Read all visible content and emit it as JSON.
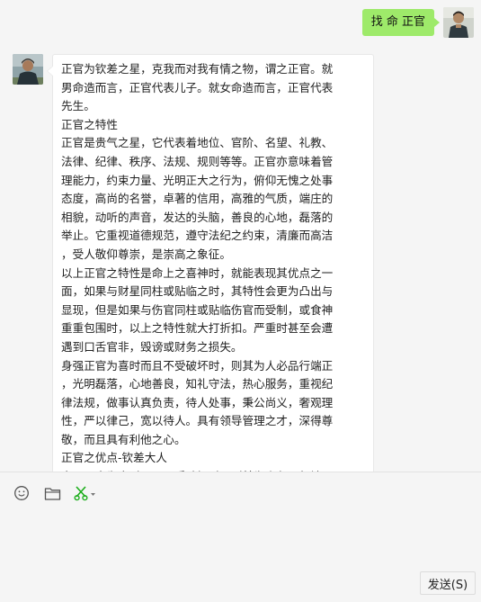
{
  "chat": {
    "outgoing_message": "找 命 正官",
    "incoming_lines": [
      "正官为钦差之星，克我而对我有情之物，谓之正官。就",
      "男命造而言，正官代表儿子。就女命造而言，正官代表",
      "先生。",
      "正官之特性",
      "正官是贵气之星，它代表着地位、官阶、名望、礼教、",
      "法律、纪律、秩序、法规、规则等等。正官亦意味着管",
      "理能力，约束力量、光明正大之行为，俯仰无愧之处事",
      "态度，高尚的名誉，卓著的信用，高雅的气质，端庄的",
      "相貌，动听的声音，发达的头脑，善良的心地，磊落的",
      "举止。它重视道德规范，遵守法纪之约束，清廉而高洁",
      "，受人敬仰尊崇，是崇高之象征。",
      "以上正官之特性是命上之喜神时，就能表现其优点之一",
      "面，如果与财星同柱或贴临之时，其特性会更为凸出与",
      "显现，但是如果与伤官同柱或贴临伤官而受制，或食神",
      "重重包围时，以上之特性就大打折扣。严重时甚至会遭",
      "遇到口舌官非，毁谤或财务之损失。",
      "身强正官为喜时而且不受破坏时，则其为人必品行端正",
      "，光明磊落，心地善良，知礼守法，热心服务，重视纪",
      "律法规，做事认真负责，待人处事，秉公尚义，奢观理",
      "性，严以律己，宽以待人。具有领导管理之才，深得尊",
      "敬，而且具有利他之心。",
      "正官之优点-钦差大人",
      "身强正官为喜时而且不受破坏时，则其为人必品行端正"
    ]
  },
  "toolbar": {
    "emoji_icon": "emoji-icon",
    "folder_icon": "folder-icon",
    "scissors_icon": "scissors-icon",
    "accent_color": "#1aad19"
  },
  "input": {
    "value": ""
  },
  "send_button": {
    "label": "发送(S)"
  }
}
